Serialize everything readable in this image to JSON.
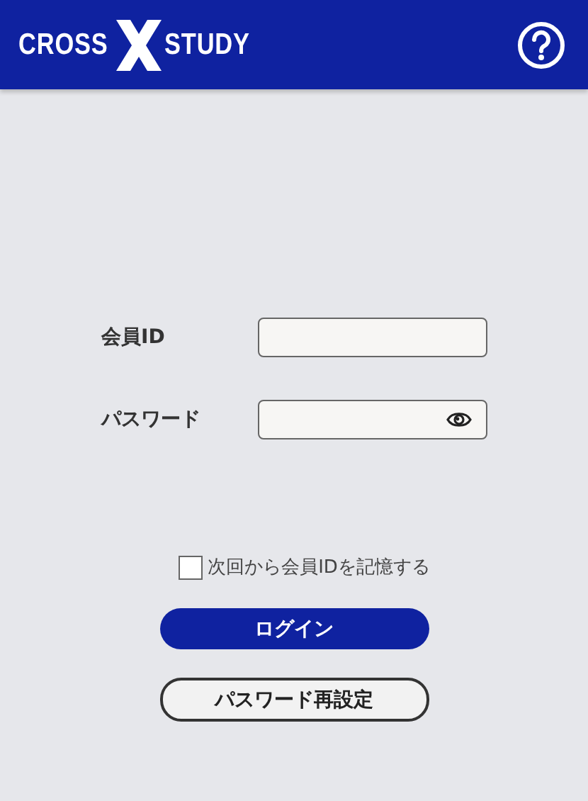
{
  "header": {
    "logo_left": "CROSS",
    "logo_right": "STUDY"
  },
  "fields": [
    {
      "label": "会員ID",
      "kind": "text"
    },
    {
      "label": "パスワード",
      "kind": "password"
    }
  ],
  "remember": {
    "label": "次回から会員IDを記憶する",
    "checked": false
  },
  "buttons": [
    {
      "label": "ログイン",
      "kind": "primary"
    },
    {
      "label": "パスワード再設定",
      "kind": "outline"
    }
  ]
}
